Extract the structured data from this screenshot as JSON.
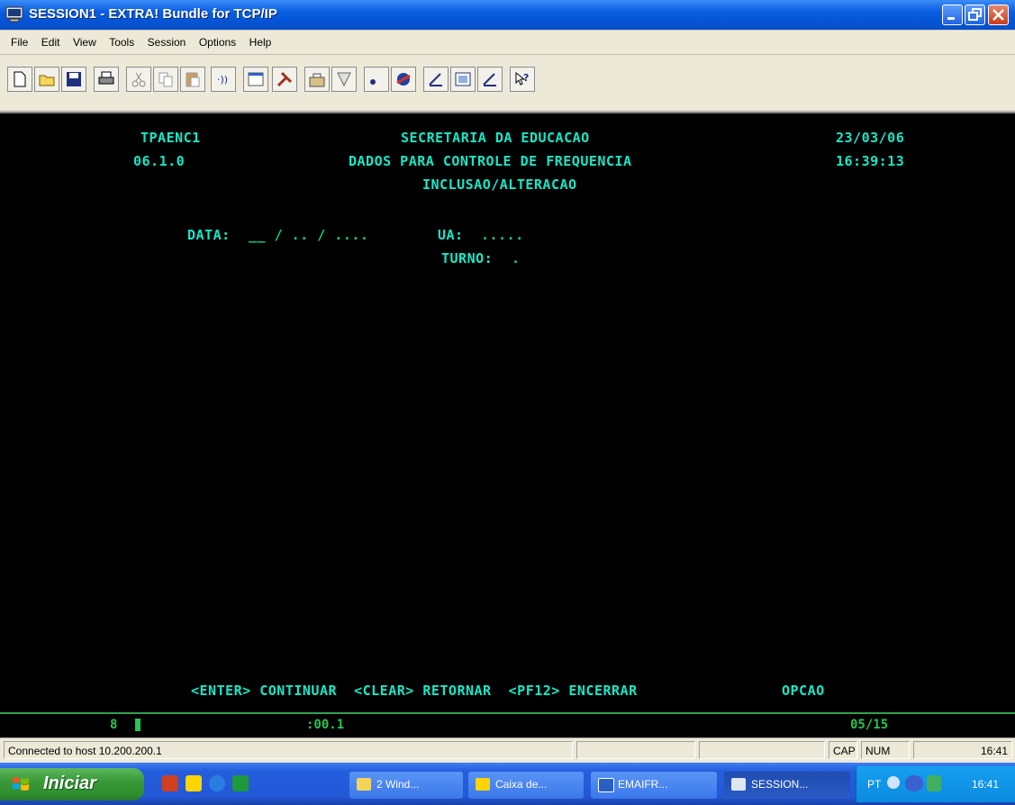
{
  "window": {
    "title": "SESSION1 - EXTRA! Bundle for TCP/IP"
  },
  "menu": [
    "File",
    "Edit",
    "View",
    "Tools",
    "Session",
    "Options",
    "Help"
  ],
  "toolbar_icons": [
    "new-icon",
    "open-icon",
    "save-icon",
    "print-icon",
    "cut-icon",
    "copy-icon",
    "paste-icon",
    "send-icon",
    "properties-icon",
    "tools-icon",
    "macro-icon",
    "hotspot-icon",
    "record-icon",
    "play-icon",
    "layout-icon",
    "keyboard-icon",
    "map-icon",
    "help-icon"
  ],
  "terminal": {
    "program": "TPAENC1",
    "version": "06.1.0",
    "org": "SECRETARIA DA EDUCACAO",
    "screen_title": "DADOS PARA CONTROLE DE FREQUENCIA",
    "mode": "INCLUSAO/ALTERACAO",
    "date": "23/03/06",
    "time": "16:39:13",
    "fields": {
      "data_label": "DATA:",
      "data_value": "__ / .. / ....",
      "ua_label": "UA:",
      "ua_value": ".....",
      "turno_label": "TURNO:",
      "turno_value": "."
    },
    "footer": "<ENTER> CONTINUAR  <CLEAR> RETORNAR  <PF12> ENCERRAR",
    "opcao": "OPCAO"
  },
  "oia": {
    "left": "8",
    "center": ":00.1",
    "right": "05/15"
  },
  "status": {
    "connection": "Connected to host 10.200.200.1",
    "cap": "CAP",
    "num": "NUM",
    "time": "16:41"
  },
  "taskbar": {
    "start": "Iniciar",
    "tasks": [
      "2 Wind...",
      "Caixa de...",
      "EMAIFR...",
      "SESSION..."
    ],
    "tray_lang": "PT",
    "tray_time": "16:41"
  },
  "colors": {
    "terminal_text": "#15e8c8",
    "field": "#0fd080",
    "oia": "#27c552",
    "titlebar": "#0455d6"
  }
}
